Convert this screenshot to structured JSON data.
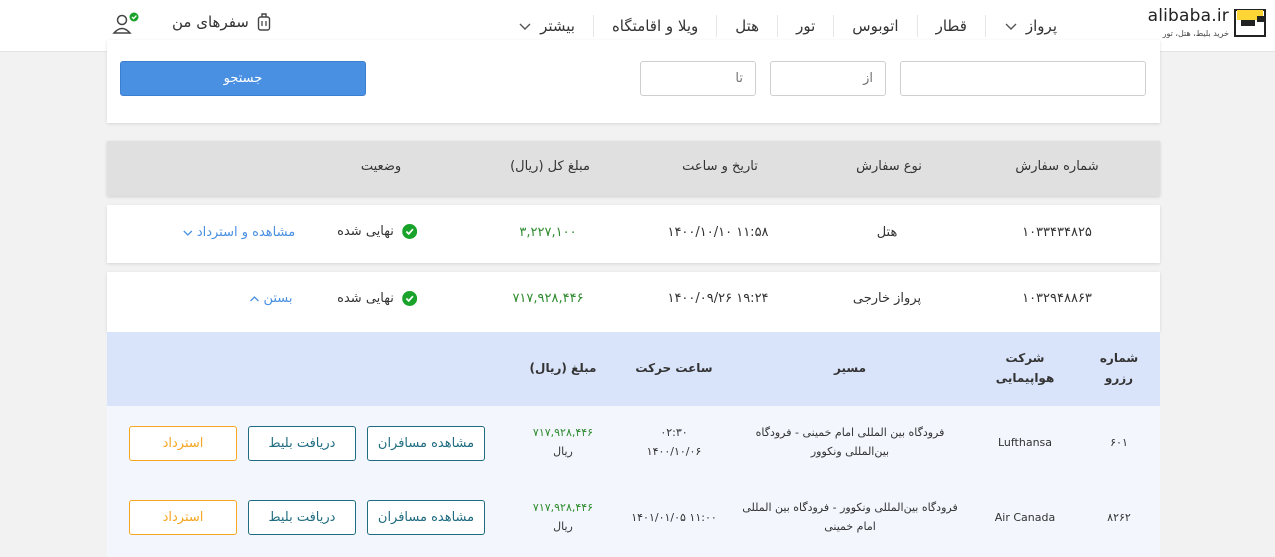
{
  "header": {
    "logo_text": "alibaba.ir",
    "logo_sub": "خرید بلیط، هتل، تور",
    "nav": [
      "پرواز",
      "قطار",
      "اتوبوس",
      "تور",
      "هتل",
      "ویلا و اقامتگاه",
      "بیشتر"
    ],
    "my_trips": "سفرهای من"
  },
  "search": {
    "from_placeholder": "از",
    "to_placeholder": "تا",
    "button": "جستجو"
  },
  "orders": {
    "columns": [
      "شماره سفارش",
      "نوع سفارش",
      "تاریخ و ساعت",
      "مبلغ کل (ریال)",
      "وضعیت"
    ],
    "rows": [
      {
        "order_no": "۱۰۳۳۴۳۴۸۲۵",
        "type": "هتل",
        "datetime": "۱۴۰۰/۱۰/۱۰ ۱۱:۵۸",
        "amount": "۳,۲۲۷,۱۰۰",
        "status": "نهایی شده",
        "action": "مشاهده و استرداد"
      },
      {
        "order_no": "۱۰۳۲۹۴۸۸۶۳",
        "type": "پرواز خارجی",
        "datetime": "۱۴۰۰/۰۹/۲۶ ۱۹:۲۴",
        "amount": "۷۱۷,۹۲۸,۴۴۶",
        "status": "نهایی شده",
        "action": "بستن"
      }
    ]
  },
  "tickets": {
    "columns": {
      "reservation": "شماره رزرو",
      "airline": "شرکت هواپیمایی",
      "route": "مسیر",
      "departure": "ساعت حرکت",
      "amount": "مبلغ (ریال)"
    },
    "rows": [
      {
        "reservation": "۶۰۱",
        "airline": "Lufthansa",
        "route": "فرودگاه بین المللی امام خمینی - فرودگاه بین‌المللی ونکوور",
        "time": "۰۲:۳۰",
        "date": "۱۴۰۰/۱۰/۰۶",
        "amount": "۷۱۷,۹۲۸,۴۴۶",
        "currency": "ریال",
        "btn_passengers": "مشاهده مسافران",
        "btn_ticket": "دریافت بلیط",
        "btn_refund": "استرداد"
      },
      {
        "reservation": "۸۲۶۲",
        "airline": "Air Canada",
        "route": "فرودگاه بین‌المللی ونکوور - فرودگاه بین المللی امام خمینی",
        "datetime": "۱۴۰۱/۰۱/۰۵ ۱۱:۰۰",
        "amount": "۷۱۷,۹۲۸,۴۴۶",
        "currency": "ریال",
        "btn_passengers": "مشاهده مسافران",
        "btn_ticket": "دریافت بلیط",
        "btn_refund": "استرداد"
      }
    ]
  },
  "colors": {
    "accent": "#4a90e2",
    "success": "#1aa32a",
    "amount": "#2e8b2e",
    "teal": "#1f6c80",
    "refund": "#f5a623",
    "subheader": "#d9e4fa"
  }
}
